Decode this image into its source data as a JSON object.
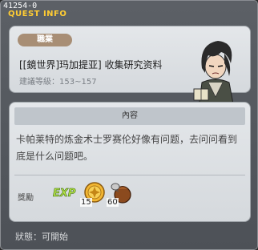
{
  "window": {
    "quest_id": "41254-0",
    "title": "QUEST INFO"
  },
  "quest": {
    "job_badge": "職業",
    "title": "[[鏡世界]玛加提亚] 收集研究资料",
    "level_label": "建議等級：153~157"
  },
  "content": {
    "header": "內容",
    "description": "卡帕莱特的炼金术士罗赛伦好像有问题，去问问看到底是什么问题吧。"
  },
  "rewards": {
    "label": "獎勵",
    "exp_label": "EXP",
    "items": [
      {
        "icon": "gold-coin-icon",
        "quantity": "15"
      },
      {
        "icon": "leather-bag-icon",
        "quantity": "60"
      }
    ]
  },
  "status": {
    "text": "狀態：可開始"
  }
}
